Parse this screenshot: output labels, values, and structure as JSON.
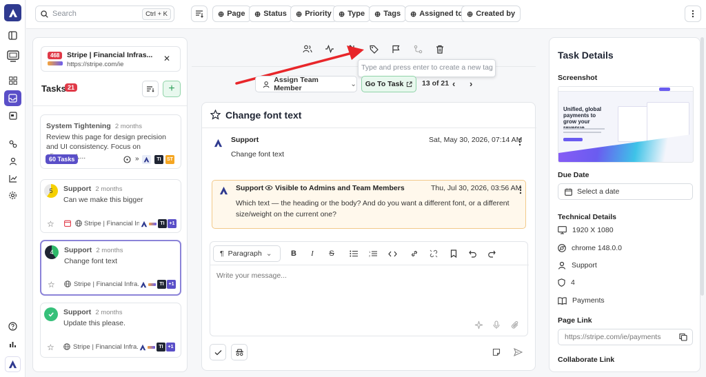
{
  "topbar": {
    "search_placeholder": "Search",
    "search_shortcut": "Ctrl + K",
    "filters": [
      "Page",
      "Status",
      "Priority",
      "Type",
      "Tags",
      "Assigned to",
      "Created by"
    ]
  },
  "project": {
    "count_badge": "468",
    "name": "Stripe | Financial Infras...",
    "url": "https://stripe.com/ie"
  },
  "task_list": {
    "title": "Tasks",
    "count": "21",
    "cards": [
      {
        "author": "System Tightening",
        "when": "2 months",
        "text": "Review this page for design precision and UI consistency. Focus on alignment,...",
        "badge": "60 Tasks",
        "avatars": [
          "TI",
          "ST"
        ]
      },
      {
        "author": "Support",
        "when": "2 months",
        "text": "Can we make this bigger",
        "status_num": "5",
        "page": "Stripe | Financial Infr...",
        "avatars": [
          "TI",
          "+1"
        ]
      },
      {
        "author": "Support",
        "when": "2 months",
        "text": "Change font text",
        "status_num": "4",
        "page": "Stripe | Financial Infra...",
        "avatars": [
          "TI",
          "+1"
        ]
      },
      {
        "author": "Support",
        "when": "2 months",
        "text": "Update this please.",
        "page": "Stripe | Financial Infra...",
        "avatars": [
          "TI",
          "+1"
        ]
      }
    ]
  },
  "center": {
    "tag_placeholder": "Type and press enter to create a new tag",
    "assign_label": "Assign Team Member",
    "goto_label": "Go To Task",
    "pager": "13 of 21",
    "task_title": "Change font text",
    "messages": [
      {
        "author": "Support",
        "time": "Sat, May 30, 2026, 07:14 AM",
        "text": "Change font text"
      },
      {
        "author": "Support",
        "visibility": "Visible to Admins and Team Members",
        "time": "Thu, Jul 30, 2026, 03:56 AM",
        "text": "Which text — the heading or the body? And do you want a different font, or a different size/weight on the current one?"
      }
    ],
    "editor_format": "Paragraph",
    "editor_placeholder": "Write your message..."
  },
  "details": {
    "title": "Task Details",
    "screenshot_label": "Screenshot",
    "screenshot_heading": "Unified, global payments to grow your revenue",
    "due_label": "Due Date",
    "due_placeholder": "Select a date",
    "tech_label": "Technical Details",
    "resolution": "1920 X 1080",
    "browser": "chrome 148.0.0",
    "reporter": "Support",
    "priority_num": "4",
    "page_name": "Payments",
    "page_link_label": "Page Link",
    "page_link": "https://stripe.com/ie/payments",
    "collab_label": "Collaborate Link"
  },
  "colors": {
    "accent": "#5a4fc8",
    "badge_red": "#e03a48",
    "success_green": "#2ea05a",
    "arrow_red": "#e8262a"
  }
}
